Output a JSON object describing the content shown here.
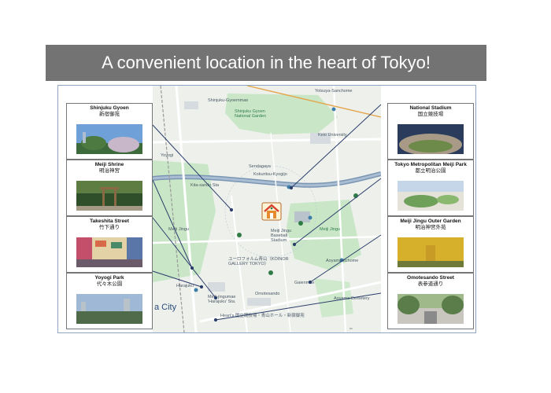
{
  "title": "A convenient location in the heart of Tokyo!",
  "map": {
    "home_icon": "house-pin-icon",
    "labels": {
      "shinjuku_gyoen": "Shinjuku Gyoen National Garden",
      "yotsuya": "Yotsuya-Sanchome",
      "shinjuku_gyoen_mae": "Shinjuku-Gyoemmae",
      "keio": "Keio University",
      "sendagaya": "Sendagaya",
      "kokuritsu": "Kokuritsu-Kyogijo",
      "kita_sando": "Kita-sando Sta",
      "meiji_jingu": "Meiji Jingu",
      "baseball": "Meiji Jingu Baseball Stadium",
      "meiji_jingu_gaien": "Meiji Jingu",
      "aoyama_itchome": "Aoyama-itchome",
      "gaienmae": "Gaienmae",
      "koinor": "ユーロフォルム青山（KOINOR GALLERY TOKYO）",
      "meiji_jingumae": "Meiji-jingumae 'Harajuku' Sta.",
      "omotesando": "Omotesando",
      "city": "a City",
      "harajuku": "Harajuku",
      "yoyogi": "Yoyogi",
      "aoyama_cemetery": "Aoyama Cemetery",
      "hearts": "Heart's 国立競技場・青山ホール・新宿御苑"
    }
  },
  "spots_left": [
    {
      "en": "Shinjuku Gyoen",
      "jp": "新宿御苑",
      "colors": [
        "#6fa0d8",
        "#3c6a3a",
        "#c8b7c9"
      ]
    },
    {
      "en": "Meiji Shrine",
      "jp": "明治神宮",
      "colors": [
        "#2f4f2a",
        "#5e7d42",
        "#8a6a44"
      ]
    },
    {
      "en": "Takeshita Street",
      "jp": "竹下通り",
      "colors": [
        "#c44f6a",
        "#5a76a8",
        "#e3d2a6"
      ]
    },
    {
      "en": "Yoyogi Park",
      "jp": "代々木公園",
      "colors": [
        "#9fb8d6",
        "#4f6b4a",
        "#b7c3c9"
      ]
    }
  ],
  "spots_right": [
    {
      "en": "National Stadium",
      "jp": "国立競技場",
      "colors": [
        "#2b3b5c",
        "#6e8a4a",
        "#a89a86"
      ]
    },
    {
      "en": "Tokyo Metropolitan Meiji Park",
      "jp": "都立明治公園",
      "colors": [
        "#c5d6e8",
        "#6fa05a",
        "#e5e2da"
      ]
    },
    {
      "en": "Meiji Jingu Outer Garden",
      "jp": "明治神宮外苑",
      "colors": [
        "#d6b02a",
        "#c89a26",
        "#6e7a3a"
      ]
    },
    {
      "en": "Omotesando Street",
      "jp": "表参道通り",
      "colors": [
        "#9fb98a",
        "#5b7d4a",
        "#c9c6c0"
      ]
    }
  ]
}
